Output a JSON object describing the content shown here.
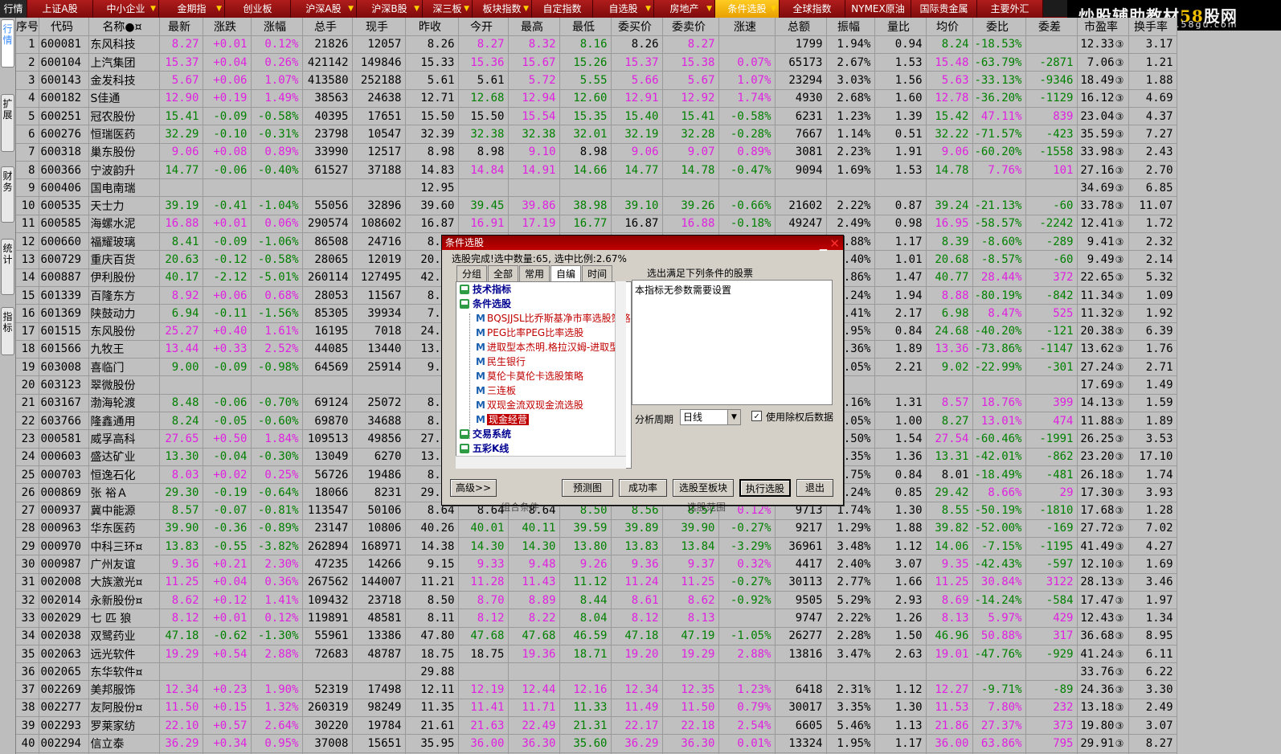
{
  "top_tabs": [
    {
      "label": "行情",
      "w": 34,
      "kind": "first"
    },
    {
      "label": "上证A股",
      "w": 82
    },
    {
      "label": "中小企业",
      "w": 82,
      "arrow": true
    },
    {
      "label": "金期指",
      "w": 82,
      "arrow": true
    },
    {
      "label": "创业板",
      "w": 82
    },
    {
      "label": "沪深A股",
      "w": 82,
      "arrow": true
    },
    {
      "label": "沪深B股",
      "w": 82,
      "arrow": true
    },
    {
      "label": "深三板",
      "w": 62,
      "arrow": true
    },
    {
      "label": "板块指数",
      "w": 74,
      "arrow": true
    },
    {
      "label": "自定指数",
      "w": 76
    },
    {
      "label": "自选股",
      "w": 76,
      "arrow": true
    },
    {
      "label": "房地产",
      "w": 76,
      "arrow": true
    },
    {
      "label": "条件选股",
      "w": 80,
      "kind": "sel",
      "arrow": true
    },
    {
      "label": "全球指数",
      "w": 82
    },
    {
      "label": "NYMEX原油",
      "w": 82
    },
    {
      "label": "国际贵金属",
      "w": 82
    },
    {
      "label": "主要外汇",
      "w": 82
    }
  ],
  "logo": {
    "main_a": "炒股辅助教材",
    "main_b": "58",
    "main_c": "股网",
    "url": "www.58gu.com"
  },
  "side_tabs": [
    "行情",
    "扩展",
    "财务",
    "统计",
    "指标"
  ],
  "columns": [
    "序号",
    "代码",
    "名称●¤",
    "最新",
    "涨跌",
    "涨幅",
    "总手",
    "现手",
    "昨收",
    "今开",
    "最高",
    "最低",
    "委买价",
    "委卖价",
    "涨速",
    "总额",
    "振幅",
    "量比",
    "均价",
    "委比",
    "委差",
    "市盈率",
    "换手率"
  ],
  "rows": [
    [
      "1",
      "600081",
      "东风科技",
      "8.27",
      "+0.01",
      "0.12%",
      "21826",
      "12057",
      "8.26",
      "8.27",
      "8.32",
      "8.16",
      "8.26",
      "8.27",
      "",
      "1799",
      "1.94%",
      "0.94",
      "8.24",
      "-18.53%",
      "",
      "12.33",
      "3.17"
    ],
    [
      "2",
      "600104",
      "上汽集团",
      "15.37",
      "+0.04",
      "0.26%",
      "421142",
      "149846",
      "15.33",
      "15.36",
      "15.67",
      "15.26",
      "15.37",
      "15.38",
      "0.07%",
      "65173",
      "2.67%",
      "1.53",
      "15.48",
      "-63.79%",
      "-2871",
      "7.06",
      "1.21"
    ],
    [
      "3",
      "600143",
      "金发科技",
      "5.67",
      "+0.06",
      "1.07%",
      "413580",
      "252188",
      "5.61",
      "5.61",
      "5.72",
      "5.55",
      "5.66",
      "5.67",
      "1.07%",
      "23294",
      "3.03%",
      "1.56",
      "5.63",
      "-33.13%",
      "-9346",
      "18.49",
      "1.88"
    ],
    [
      "4",
      "600182",
      "S佳通",
      "12.90",
      "+0.19",
      "1.49%",
      "38563",
      "24638",
      "12.71",
      "12.68",
      "12.94",
      "12.60",
      "12.91",
      "12.92",
      "1.74%",
      "4930",
      "2.68%",
      "1.60",
      "12.78",
      "-36.20%",
      "-1129",
      "16.12",
      "4.69"
    ],
    [
      "5",
      "600251",
      "冠农股份",
      "15.41",
      "-0.09",
      "-0.58%",
      "40395",
      "17651",
      "15.50",
      "15.50",
      "15.54",
      "15.35",
      "15.40",
      "15.41",
      "-0.58%",
      "6231",
      "1.23%",
      "1.39",
      "15.42",
      "47.11%",
      "839",
      "23.04",
      "4.37"
    ],
    [
      "6",
      "600276",
      "恒瑞医药",
      "32.29",
      "-0.10",
      "-0.31%",
      "23798",
      "10547",
      "32.39",
      "32.38",
      "32.38",
      "32.01",
      "32.19",
      "32.28",
      "-0.28%",
      "7667",
      "1.14%",
      "0.51",
      "32.22",
      "-71.57%",
      "-423",
      "35.59",
      "7.27"
    ],
    [
      "7",
      "600318",
      "巢东股份",
      "9.06",
      "+0.08",
      "0.89%",
      "33990",
      "12517",
      "8.98",
      "8.98",
      "9.10",
      "8.98",
      "9.06",
      "9.07",
      "0.89%",
      "3081",
      "2.23%",
      "1.91",
      "9.06",
      "-60.20%",
      "-1558",
      "33.98",
      "2.43"
    ],
    [
      "8",
      "600366",
      "宁波韵升",
      "14.77",
      "-0.06",
      "-0.40%",
      "61527",
      "37188",
      "14.83",
      "14.84",
      "14.91",
      "14.66",
      "14.77",
      "14.78",
      "-0.47%",
      "9094",
      "1.69%",
      "1.53",
      "14.78",
      "7.76%",
      "101",
      "27.16",
      "2.70"
    ],
    [
      "9",
      "600406",
      "国电南瑞",
      "",
      "",
      "",
      "",
      "",
      "12.95",
      "",
      "",
      "",
      "",
      "",
      "",
      "",
      "",
      "",
      "",
      "",
      "",
      "34.69",
      "6.85"
    ],
    [
      "10",
      "600535",
      "天士力",
      "39.19",
      "-0.41",
      "-1.04%",
      "55056",
      "32896",
      "39.60",
      "39.45",
      "39.86",
      "38.98",
      "39.10",
      "39.26",
      "-0.66%",
      "21602",
      "2.22%",
      "0.87",
      "39.24",
      "-21.13%",
      "-60",
      "33.78",
      "11.07"
    ],
    [
      "11",
      "600585",
      "海螺水泥",
      "16.88",
      "+0.01",
      "0.06%",
      "290574",
      "108602",
      "16.87",
      "16.91",
      "17.19",
      "16.77",
      "16.87",
      "16.88",
      "-0.18%",
      "49247",
      "2.49%",
      "0.98",
      "16.95",
      "-58.57%",
      "-2242",
      "12.41",
      "1.72"
    ],
    [
      "12",
      "600660",
      "福耀玻璃",
      "8.41",
      "-0.09",
      "-1.06%",
      "86508",
      "24716",
      "8.50",
      "8.50",
      "8.56",
      "8.40",
      "8.41",
      "8.42",
      "-0.12%",
      "7262",
      "1.88%",
      "1.17",
      "8.39",
      "-8.60%",
      "-289",
      "9.41",
      "2.32"
    ],
    [
      "13",
      "600729",
      "重庆百货",
      "20.63",
      "-0.12",
      "-0.58%",
      "28065",
      "12019",
      "20.75",
      "20.75",
      "20.80",
      "20.55",
      "20.63",
      "20.64",
      "-0.05%",
      "5804",
      "1.40%",
      "1.01",
      "20.68",
      "-8.57%",
      "-60",
      "9.49",
      "2.14"
    ],
    [
      "14",
      "600887",
      "伊利股份",
      "40.17",
      "-2.12",
      "-5.01%",
      "260114",
      "127495",
      "42.29",
      "42.29",
      "42.29",
      "39.81",
      "40.17",
      "40.18",
      "-0.32%",
      "105948",
      "5.86%",
      "1.47",
      "40.77",
      "28.44%",
      "372",
      "22.65",
      "5.32"
    ],
    [
      "15",
      "601339",
      "百隆东方",
      "8.92",
      "+0.06",
      "0.68%",
      "28053",
      "11567",
      "8.86",
      "8.86",
      "8.95",
      "8.84",
      "8.91",
      "8.92",
      "0.11%",
      "2492",
      "1.24%",
      "1.94",
      "8.88",
      "-80.19%",
      "-842",
      "11.34",
      "1.09"
    ],
    [
      "16",
      "601369",
      "陕鼓动力",
      "6.94",
      "-0.11",
      "-1.56%",
      "85305",
      "39934",
      "7.05",
      "7.05",
      "7.06",
      "6.89",
      "6.93",
      "6.94",
      "-0.29%",
      "5958",
      "2.41%",
      "2.17",
      "6.98",
      "8.47%",
      "525",
      "11.32",
      "1.92"
    ],
    [
      "17",
      "601515",
      "东风股份",
      "25.27",
      "+0.40",
      "1.61%",
      "16195",
      "7018",
      "24.87",
      "24.87",
      "25.43",
      "24.20",
      "25.27",
      "25.28",
      "0.04%",
      "3996",
      "4.95%",
      "0.84",
      "24.68",
      "-40.20%",
      "-121",
      "20.38",
      "6.39"
    ],
    [
      "18",
      "601566",
      "九牧王",
      "13.44",
      "+0.33",
      "2.52%",
      "44085",
      "13440",
      "13.11",
      "13.11",
      "13.49",
      "13.05",
      "13.43",
      "13.44",
      "0.08%",
      "5891",
      "3.36%",
      "1.89",
      "13.36",
      "-73.86%",
      "-1147",
      "13.62",
      "1.76"
    ],
    [
      "19",
      "603008",
      "喜临门",
      "9.00",
      "-0.09",
      "-0.98%",
      "64569",
      "25914",
      "9.09",
      "9.09",
      "9.18",
      "8.90",
      "8.99",
      "9.00",
      "-0.11%",
      "5824",
      "3.05%",
      "2.21",
      "9.02",
      "-22.99%",
      "-301",
      "27.24",
      "2.71"
    ],
    [
      "20",
      "603123",
      "翠微股份",
      "",
      "",
      "",
      "",
      "",
      "",
      "",
      "",
      "",
      "",
      "",
      "",
      "",
      "",
      "",
      "",
      "",
      "",
      "17.69",
      "1.49"
    ],
    [
      "21",
      "603167",
      "渤海轮渡",
      "8.48",
      "-0.06",
      "-0.70%",
      "69124",
      "25072",
      "8.54",
      "8.54",
      "8.61",
      "8.34",
      "8.48",
      "8.49",
      "0.00%",
      "5927",
      "3.16%",
      "1.31",
      "8.57",
      "18.76%",
      "399",
      "14.13",
      "1.59"
    ],
    [
      "22",
      "603766",
      "隆鑫通用",
      "8.24",
      "-0.05",
      "-0.60%",
      "69870",
      "34688",
      "8.29",
      "8.29",
      "8.31",
      "8.14",
      "8.24",
      "8.25",
      "0.12%",
      "5752",
      "2.05%",
      "1.00",
      "8.27",
      "13.01%",
      "474",
      "11.88",
      "1.89"
    ],
    [
      "23",
      "000581",
      "威孚高科",
      "27.65",
      "+0.50",
      "1.84%",
      "109513",
      "49856",
      "27.15",
      "27.15",
      "27.80",
      "27.12",
      "27.65",
      "27.66",
      "0.04%",
      "30058",
      "2.50%",
      "1.54",
      "27.54",
      "-60.46%",
      "-1991",
      "26.25",
      "3.53"
    ],
    [
      "24",
      "000603",
      "盛达矿业",
      "13.30",
      "-0.04",
      "-0.30%",
      "13049",
      "6270",
      "13.34",
      "13.34",
      "13.42",
      "13.24",
      "13.30",
      "13.31",
      "0.00%",
      "1737",
      "1.35%",
      "1.36",
      "13.31",
      "-42.01%",
      "-862",
      "23.20",
      "17.10"
    ],
    [
      "25",
      "000703",
      "恒逸石化",
      "8.03",
      "+0.02",
      "0.25%",
      "56726",
      "19486",
      "8.01",
      "8.01",
      "8.09",
      "7.87",
      "8.03",
      "8.04",
      "0.12%",
      "4546",
      "2.75%",
      "0.84",
      "8.01",
      "-18.49%",
      "-481",
      "26.18",
      "1.74"
    ],
    [
      "26",
      "000869",
      "张 裕Ａ",
      "29.30",
      "-0.19",
      "-0.64%",
      "18066",
      "8231",
      "29.49",
      "29.49",
      "29.60",
      "28.94",
      "29.30",
      "29.31",
      "0.03%",
      "5315",
      "2.24%",
      "0.85",
      "29.42",
      "8.66%",
      "29",
      "17.30",
      "3.93"
    ],
    [
      "27",
      "000937",
      "冀中能源",
      "8.57",
      "-0.07",
      "-0.81%",
      "113547",
      "50106",
      "8.64",
      "8.64",
      "8.64",
      "8.50",
      "8.56",
      "8.57",
      "0.12%",
      "9713",
      "1.74%",
      "1.30",
      "8.55",
      "-50.19%",
      "-1810",
      "17.68",
      "1.28"
    ],
    [
      "28",
      "000963",
      "华东医药",
      "39.90",
      "-0.36",
      "-0.89%",
      "23147",
      "10806",
      "40.26",
      "40.01",
      "40.11",
      "39.59",
      "39.89",
      "39.90",
      "-0.27%",
      "9217",
      "1.29%",
      "1.88",
      "39.82",
      "-52.00%",
      "-169",
      "27.72",
      "7.02"
    ],
    [
      "29",
      "000970",
      "中科三环¤",
      "13.83",
      "-0.55",
      "-3.82%",
      "262894",
      "168971",
      "14.38",
      "14.30",
      "14.30",
      "13.80",
      "13.83",
      "13.84",
      "-3.29%",
      "36961",
      "3.48%",
      "1.12",
      "14.06",
      "-7.15%",
      "-1195",
      "41.49",
      "4.27"
    ],
    [
      "30",
      "000987",
      "广州友谊",
      "9.36",
      "+0.21",
      "2.30%",
      "47235",
      "14266",
      "9.15",
      "9.33",
      "9.48",
      "9.26",
      "9.36",
      "9.37",
      "0.32%",
      "4417",
      "2.40%",
      "3.07",
      "9.35",
      "-42.43%",
      "-597",
      "12.10",
      "1.69"
    ],
    [
      "31",
      "002008",
      "大族激光¤",
      "11.25",
      "+0.04",
      "0.36%",
      "267562",
      "144007",
      "11.21",
      "11.28",
      "11.43",
      "11.12",
      "11.24",
      "11.25",
      "-0.27%",
      "30113",
      "2.77%",
      "1.66",
      "11.25",
      "30.84%",
      "3122",
      "28.13",
      "3.46"
    ],
    [
      "32",
      "002014",
      "永新股份¤",
      "8.62",
      "+0.12",
      "1.41%",
      "109432",
      "23718",
      "8.50",
      "8.70",
      "8.89",
      "8.44",
      "8.61",
      "8.62",
      "-0.92%",
      "9505",
      "5.29%",
      "2.93",
      "8.69",
      "-14.24%",
      "-584",
      "17.47",
      "1.97"
    ],
    [
      "33",
      "002029",
      "七 匹 狼",
      "8.12",
      "+0.01",
      "0.12%",
      "119891",
      "48581",
      "8.11",
      "8.12",
      "8.22",
      "8.04",
      "8.12",
      "8.13",
      "",
      "9747",
      "2.22%",
      "1.26",
      "8.13",
      "5.97%",
      "429",
      "12.43",
      "1.34"
    ],
    [
      "34",
      "002038",
      "双鹭药业",
      "47.18",
      "-0.62",
      "-1.30%",
      "55961",
      "13386",
      "47.80",
      "47.68",
      "47.68",
      "46.59",
      "47.18",
      "47.19",
      "-1.05%",
      "26277",
      "2.28%",
      "1.50",
      "46.96",
      "50.88%",
      "317",
      "36.68",
      "8.95"
    ],
    [
      "35",
      "002063",
      "远光软件",
      "19.29",
      "+0.54",
      "2.88%",
      "72683",
      "48787",
      "18.75",
      "18.75",
      "19.36",
      "18.71",
      "19.20",
      "19.29",
      "2.88%",
      "13816",
      "3.47%",
      "2.63",
      "19.01",
      "-47.76%",
      "-929",
      "41.24",
      "6.11"
    ],
    [
      "36",
      "002065",
      "东华软件¤",
      "",
      "",
      "",
      "",
      "",
      "29.88",
      "",
      "",
      "",
      "",
      "",
      "",
      "",
      "",
      "",
      "",
      "",
      "",
      "33.76",
      "6.22"
    ],
    [
      "37",
      "002269",
      "美邦服饰",
      "12.34",
      "+0.23",
      "1.90%",
      "52319",
      "17498",
      "12.11",
      "12.19",
      "12.44",
      "12.16",
      "12.34",
      "12.35",
      "1.23%",
      "6418",
      "2.31%",
      "1.12",
      "12.27",
      "-9.71%",
      "-89",
      "24.36",
      "3.30"
    ],
    [
      "38",
      "002277",
      "友阿股份¤",
      "11.50",
      "+0.15",
      "1.32%",
      "260319",
      "98249",
      "11.35",
      "11.41",
      "11.71",
      "11.33",
      "11.49",
      "11.50",
      "0.79%",
      "30017",
      "3.35%",
      "1.30",
      "11.53",
      "7.80%",
      "232",
      "13.18",
      "2.49"
    ],
    [
      "39",
      "002293",
      "罗莱家纺",
      "22.10",
      "+0.57",
      "2.64%",
      "30220",
      "19784",
      "21.61",
      "21.63",
      "22.49",
      "21.31",
      "22.17",
      "22.18",
      "2.54%",
      "6605",
      "5.46%",
      "1.13",
      "21.86",
      "27.37%",
      "373",
      "19.80",
      "3.07"
    ],
    [
      "40",
      "002294",
      "信立泰",
      "36.29",
      "+0.34",
      "0.95%",
      "37008",
      "15651",
      "35.95",
      "36.00",
      "36.30",
      "35.60",
      "36.29",
      "36.30",
      "0.01%",
      "13324",
      "1.95%",
      "1.17",
      "36.00",
      "63.86%",
      "795",
      "29.91",
      "8.27"
    ],
    [
      "41",
      "002304",
      "洋河股份",
      "43.75",
      "-0.20",
      "-0.45%",
      "37700",
      "12375",
      "43.95",
      "43.84",
      "44.71",
      "43.47",
      "43.75",
      "43.76",
      "-0.21%",
      "16581",
      "2.82%",
      "0.61",
      "44.10",
      "50.48%",
      "250",
      "7.87",
      "7.56"
    ]
  ],
  "dialog": {
    "title": "条件选股",
    "status": "选股完成!选中数量:65, 选中比例:2.67%",
    "tabs": [
      "分组",
      "全部",
      "常用",
      "自编",
      "时间"
    ],
    "selected_tab": "自编",
    "tree": [
      {
        "type": "cat",
        "label": "技术指标"
      },
      {
        "type": "cat",
        "label": "条件选股"
      },
      {
        "type": "leaf",
        "label": "BQSJJSL比乔斯基净市率选股策略"
      },
      {
        "type": "leaf",
        "label": "PEG比率PEG比率选股"
      },
      {
        "type": "leaf",
        "label": "进取型本杰明.格拉汉姆-进取型"
      },
      {
        "type": "leaf",
        "label": "民生银行"
      },
      {
        "type": "leaf",
        "label": "莫伦卡莫伦卡选股策略"
      },
      {
        "type": "leaf",
        "label": "三连板"
      },
      {
        "type": "leaf",
        "label": "双现金流双现金流选股"
      },
      {
        "type": "leaf",
        "label": "现金经营",
        "selected": true
      },
      {
        "type": "cat",
        "label": "交易系统"
      },
      {
        "type": "cat",
        "label": "五彩K线"
      }
    ],
    "desc_title": "选出满足下列条件的股票",
    "desc_text": "本指标无参数需要设置",
    "period_label": "分析周期",
    "period_value": "日线",
    "adjust_label": "使用除权后数据",
    "adjust_checked": "✓",
    "buttons": {
      "advanced": "高级>>",
      "preview": "预测图",
      "success": "成功率",
      "to_block": "选股至板块",
      "execute": "执行选股",
      "exit": "退出"
    },
    "peek_left": "组合条件",
    "peek_right": "选股范围"
  },
  "colors": {
    "up": "#e020e0",
    "down": "#008000",
    "bg": "#c0c0c0",
    "tab_red": "#a01010",
    "tab_sel": "#f0b000"
  }
}
